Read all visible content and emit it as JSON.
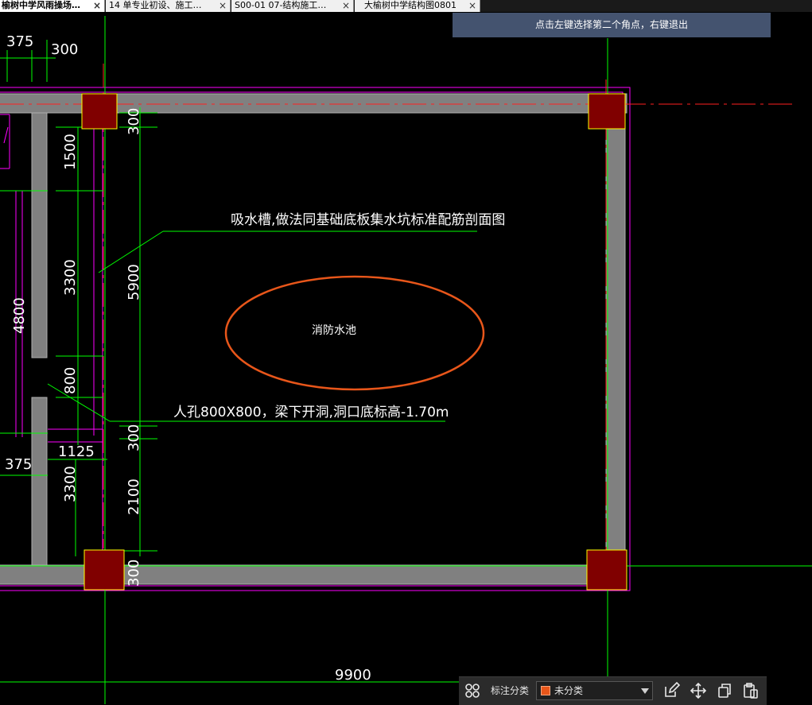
{
  "tabs": [
    {
      "label": "榆树中学风雨操场…",
      "close": "×",
      "active": true
    },
    {
      "label": "14 单专业初设、施工…",
      "close": "×",
      "active": false
    },
    {
      "label": "S00-01 07-结构施工…",
      "close": "×",
      "active": false
    },
    {
      "label": "大榆树中学结构图0801",
      "close": "×",
      "active": false
    }
  ],
  "prompt": "点击左键选择第二个角点，右键退出",
  "drawing": {
    "dims": {
      "d375_top": "375",
      "d300_top": "300",
      "d300_right1": "300",
      "d1500": "1500",
      "d5900": "5900",
      "d3300_upper": "3300",
      "d4800": "4800",
      "d800": "800",
      "d300_mid": "300",
      "d1125": "1125",
      "d375_bottom": "375",
      "d3300_lower": "3300",
      "d2100": "2100",
      "d300_bottom": "300",
      "d9900": "9900"
    },
    "annotations": {
      "sump_note": "吸水槽,做法同基础底板集水坑标准配筋剖面图",
      "pool_label": "消防水池",
      "manhole_note": "人孔800X800，梁下开洞,洞口底标高-1.70m"
    },
    "colors": {
      "wall": "#808080",
      "column_fill": "#800000",
      "column_border": "#ffff00",
      "dim_line": "#00ff00",
      "axis_line": "#ff0000",
      "outline": "#ff00ff",
      "ellipse": "#e8561a"
    }
  },
  "toolbar": {
    "layers_icon": "layers-icon",
    "label": "标注分类",
    "select_value": "未分类",
    "edit_icon": "edit-icon",
    "move_icon": "move-icon",
    "copy_icon": "copy-icon",
    "paste_icon": "paste-icon"
  }
}
